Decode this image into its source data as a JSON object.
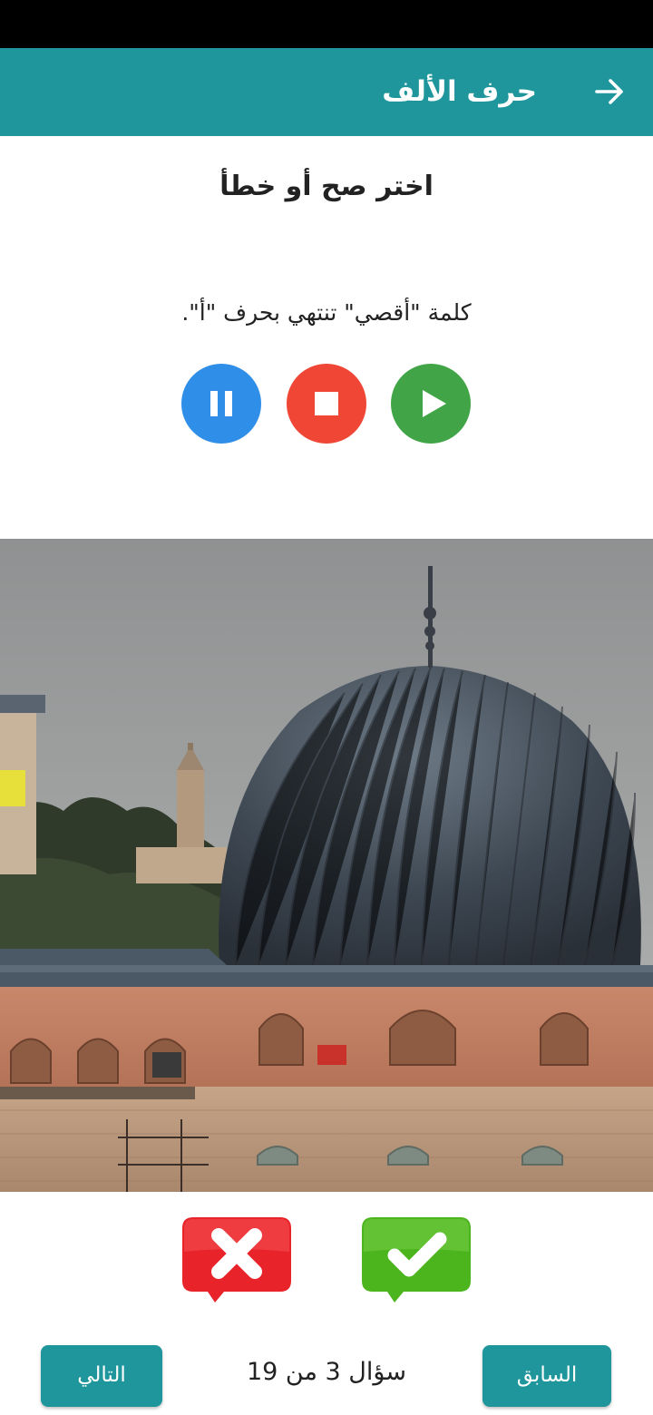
{
  "app_bar": {
    "title": "حرف الألف",
    "back_icon": "arrow-right-icon"
  },
  "quiz": {
    "prompt": "اختر صح أو خطأ",
    "question": "كلمة \"أقصي\" تنتهي بحرف \"أ\".",
    "audio_controls": {
      "pause_icon": "pause-icon",
      "stop_icon": "stop-icon",
      "play_icon": "play-icon"
    },
    "image_subject": "al-aqsa-mosque-dome"
  },
  "answers": {
    "false_icon": "cross-mark-icon",
    "true_icon": "check-mark-icon"
  },
  "navigation": {
    "previous_label": "السابق",
    "counter_text": "سؤال 3 من 19",
    "next_label": "التالي"
  },
  "colors": {
    "app_bar": "#1f969b",
    "pause": "#2f8ee8",
    "stop": "#ef4636",
    "play": "#41a547",
    "false_answer": "#e8232a",
    "true_answer": "#4cb51e"
  }
}
